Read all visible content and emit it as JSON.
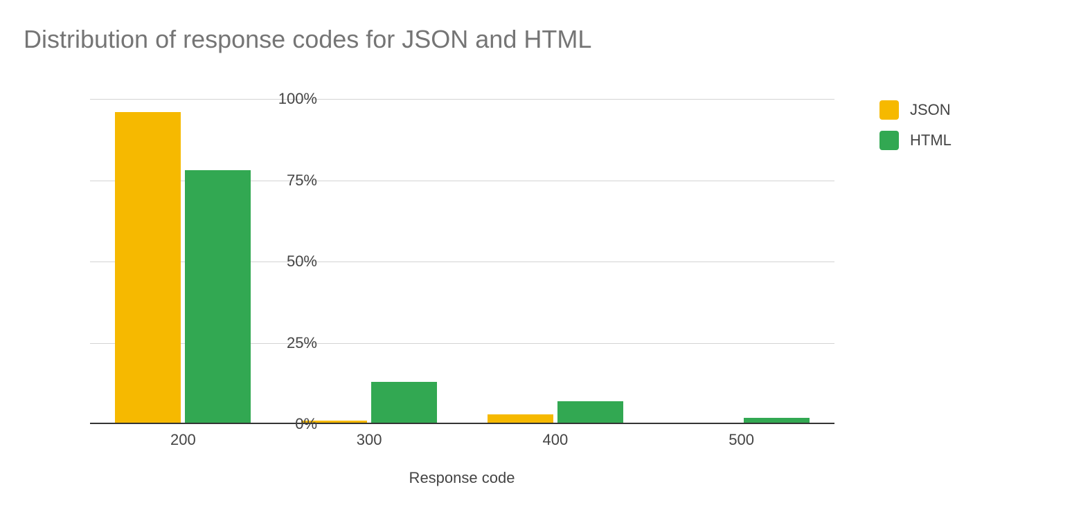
{
  "chart_data": {
    "type": "bar",
    "title": "Distribution of response codes for JSON and HTML",
    "xlabel": "Response code",
    "ylabel": "",
    "ylim": [
      0,
      100
    ],
    "y_ticks": [
      0,
      25,
      50,
      75,
      100
    ],
    "y_tick_labels": [
      "0%",
      "25%",
      "50%",
      "75%",
      "100%"
    ],
    "categories": [
      "200",
      "300",
      "400",
      "500"
    ],
    "series": [
      {
        "name": "JSON",
        "color": "#f6b900",
        "values": [
          96,
          1,
          3,
          0
        ]
      },
      {
        "name": "HTML",
        "color": "#32a852",
        "values": [
          78,
          13,
          7,
          2
        ]
      }
    ]
  }
}
